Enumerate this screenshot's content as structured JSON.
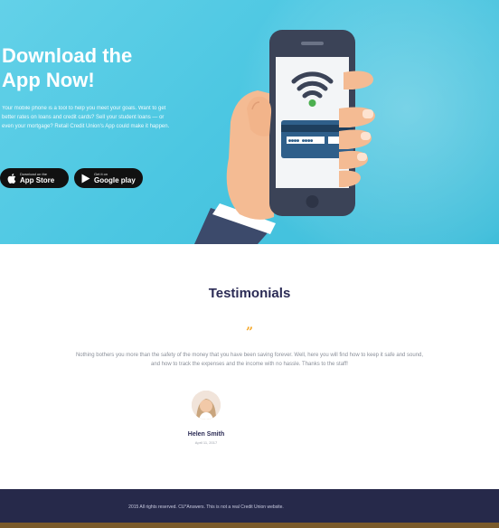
{
  "hero": {
    "title_line1": "Download the",
    "title_line2": "App Now!",
    "description": "Your mobile phone is a tool to help you meet your goals. Want to get better rates on loans and credit cards? Sell your student loans — or even your mortgage? Retail Credit Union's App could make it happen.",
    "app_store": {
      "small": "Download on the",
      "big": "App Store",
      "icon": "apple-icon"
    },
    "google_play": {
      "small": "Get it on",
      "big": "Google play",
      "icon": "play-icon"
    },
    "background_color": "#4cc7e2"
  },
  "testimonials": {
    "title": "Testimonials",
    "quote_mark": "”",
    "text": "Nothing bothers you more than the safety of the money that you have been saving forever. Well, here you will find how to keep it safe and sound, and how to track the expenses and the income with no hassle. Thanks to the staff!",
    "author_name": "Helen Smith",
    "author_date": "April 11, 2017",
    "accent_color": "#f5a623"
  },
  "footer": {
    "text": "2015 All rights reserved. CU*Answers. This is not a real Credit Union website.",
    "background_color": "#26294a"
  }
}
